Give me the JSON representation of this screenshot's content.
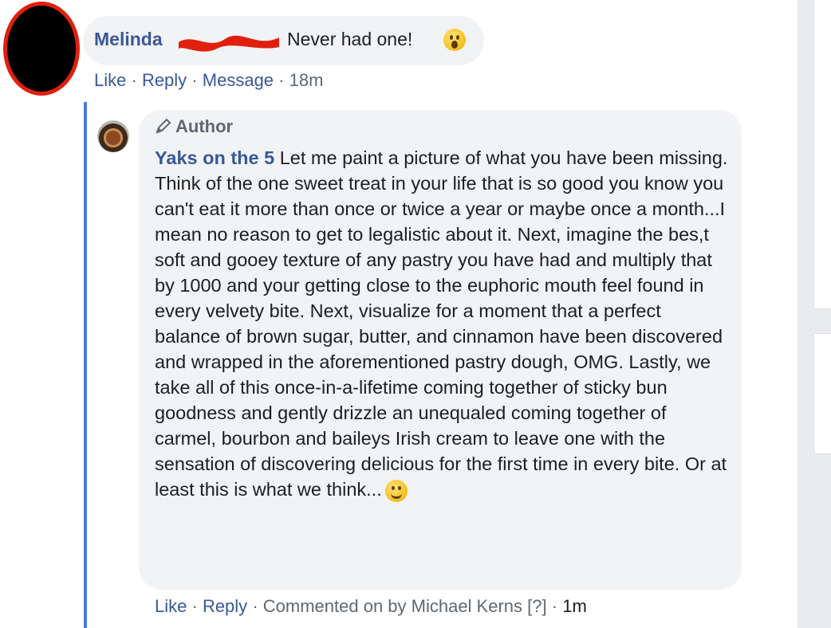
{
  "comment1": {
    "author": "Melinda",
    "text": "Never had one!",
    "emoji": "open-mouth-emoji",
    "actions": {
      "like": "Like",
      "reply": "Reply",
      "message": "Message",
      "time": "18m"
    }
  },
  "reply": {
    "badge": "Author",
    "badge_icon": "pencil-icon",
    "author": "Yaks on the 5",
    "text": "Let me paint a picture of what you have been missing. Think of the one sweet treat in your life that is so good you know you can't eat it more than once or twice a year or maybe once a month...I mean no reason to get to legalistic about it. Next, imagine the bes,t soft and gooey texture of any pastry you have had and multiply that by 1000 and your getting close to the euphoric mouth feel found in every velvety bite. Next, visualize for a moment that a perfect balance of brown sugar, butter, and cinnamon have been discovered and wrapped in the aforementioned pastry dough, OMG. Lastly, we take all of this once-in-a-lifetime coming together of sticky bun goodness and gently drizzle an unequaled coming together of carmel, bourbon and baileys Irish cream to leave one with the sensation of discovering delicious for the first time in every bite. Or at least this is what we think...",
    "emoji": "smile-emoji",
    "actions": {
      "like": "Like",
      "reply": "Reply",
      "commented_by": "Commented on by Michael Kerns",
      "help": "[?]",
      "time": "1m"
    }
  },
  "separator": "·",
  "colors": {
    "link": "#385898",
    "bubble": "#f2f3f5",
    "thread": "#4a79d8",
    "redaction": "#e0200d"
  }
}
